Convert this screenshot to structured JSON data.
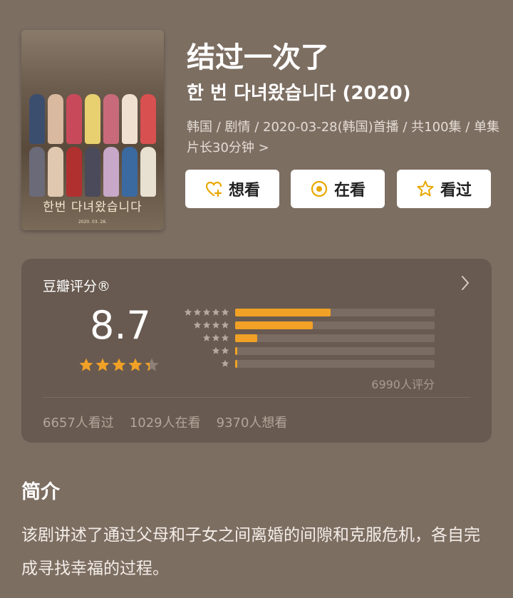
{
  "poster": {
    "title_text": "한번 다녀왔습니다",
    "date_text": "2020. 03. 28."
  },
  "title": "结过一次了",
  "subtitle": "한 번 다녀왔습니다 (2020)",
  "meta": "韩国 / 剧情 / 2020-03-28(韩国)首播 / 共100集 / 单集片长30分钟 >",
  "actions": {
    "want": "想看",
    "watching": "在看",
    "watched": "看过"
  },
  "rating": {
    "label": "豆瓣评分®",
    "score": "8.7",
    "stars_value": 4.35,
    "distribution": [
      {
        "stars": 5,
        "percent": 48
      },
      {
        "stars": 4,
        "percent": 39
      },
      {
        "stars": 3,
        "percent": 11
      },
      {
        "stars": 2,
        "percent": 1
      },
      {
        "stars": 1,
        "percent": 1
      }
    ],
    "count_text": "6990人评分",
    "stats": {
      "watched": "6657人看过",
      "watching": "1029人在看",
      "want": "9370人想看"
    }
  },
  "intro": {
    "heading": "简介",
    "text": "该剧讲述了通过父母和子女之间离婚的间隙和克服危机，各自完成寻找幸福的过程。"
  },
  "colors": {
    "background": "#7d6e62",
    "card": "#685a50",
    "accent_orange": "#f1a125",
    "icon_yellow": "#e8a800"
  }
}
